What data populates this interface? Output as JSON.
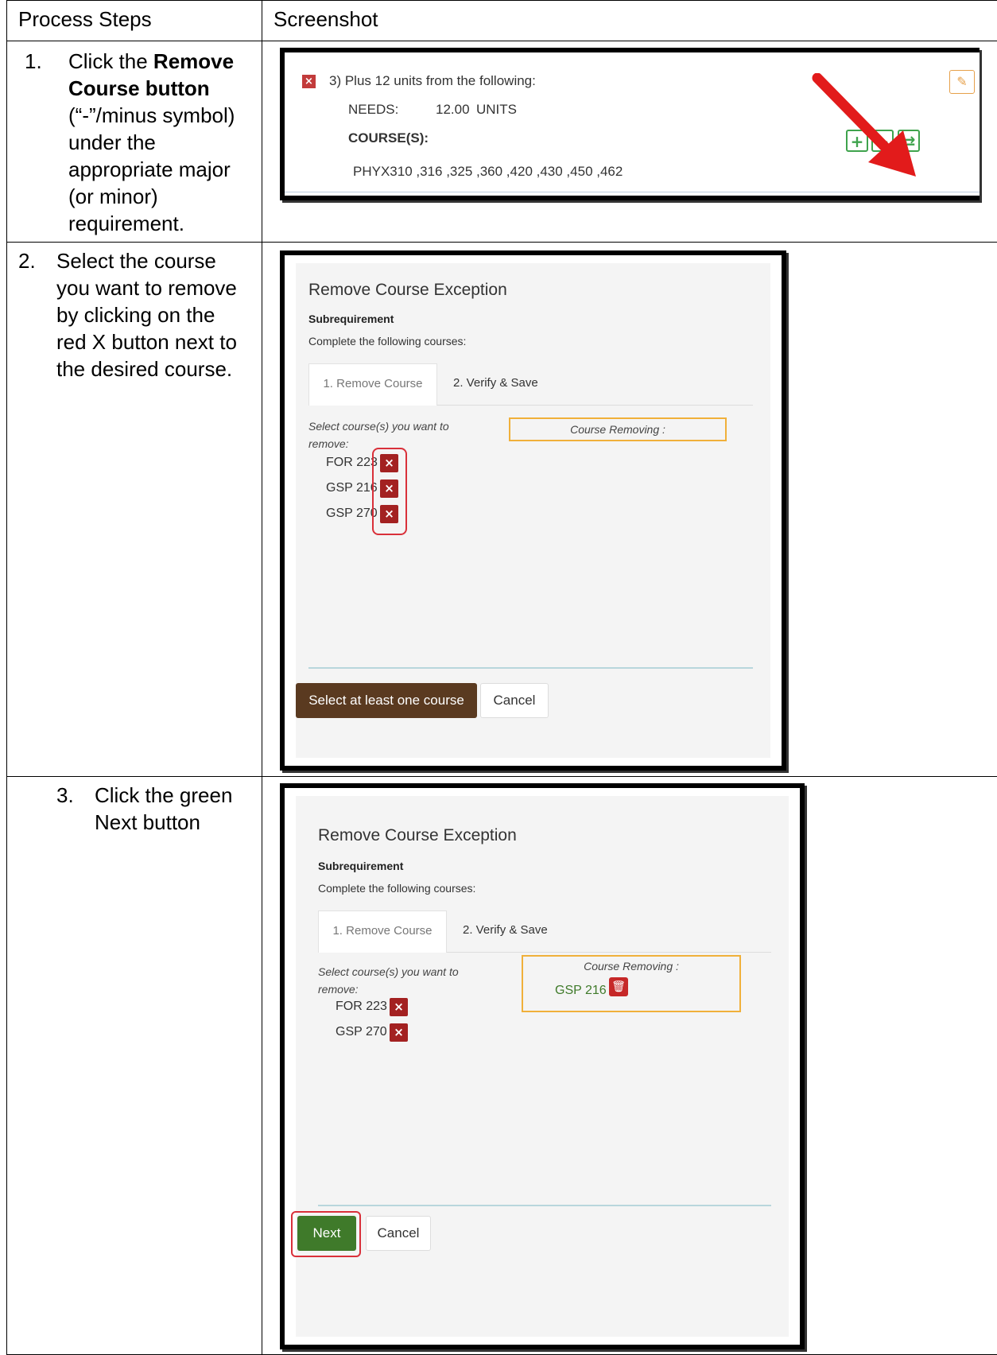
{
  "table": {
    "header_steps": "Process Steps",
    "header_screenshot": "Screenshot"
  },
  "step1": {
    "number": "1.",
    "text_a": "Click the ",
    "text_bold": "Remove Course button",
    "text_b": " (“-”/minus symbol) under the appropriate major (or minor) requirement.",
    "shot": {
      "req_line": "3) Plus 12 units from the following:",
      "needs_label": "NEEDS:",
      "needs_value": "12.00",
      "units_label": "UNITS",
      "courses_label": "COURSE(S):",
      "course_list": "PHYX310 ,316 ,325 ,360 ,420 ,430 ,450 ,462",
      "add_symbol": "+",
      "remove_symbol": "−",
      "swap_symbol": "⇄"
    }
  },
  "step2": {
    "number": "2.",
    "text": "Select the course you want to remove by clicking on the red X button next to the desired course.",
    "dialog": {
      "title": "Remove Course Exception",
      "subrequirement": "Subrequirement",
      "complete_text": "Complete the following courses:",
      "tab1": "1. Remove Course",
      "tab2": "2. Verify & Save",
      "instruction": "Select course(s) you want to remove:",
      "removing_label": "Course Removing :",
      "courses": [
        "FOR 223",
        "GSP 216",
        "GSP 270"
      ],
      "primary_button": "Select at least one course",
      "cancel_button": "Cancel"
    }
  },
  "step3": {
    "number": "3.",
    "text": "Click the green Next button",
    "dialog": {
      "title": "Remove Course Exception",
      "subrequirement": "Subrequirement",
      "complete_text": "Complete the following courses:",
      "tab1": "1. Remove Course",
      "tab2": "2. Verify & Save",
      "instruction": "Select course(s) you want to remove:",
      "removing_label": "Course Removing :",
      "removing_course": "GSP 216",
      "courses": [
        "FOR 223",
        "GSP 270"
      ],
      "next_button": "Next",
      "cancel_button": "Cancel"
    }
  },
  "colors": {
    "remove_x": "#a32121",
    "green_outline": "#3fa34d",
    "brown_button": "#5a3a20",
    "next_green": "#3f7a2a",
    "arrow_red": "#e21b1b",
    "removing_border": "#f0b03a"
  }
}
